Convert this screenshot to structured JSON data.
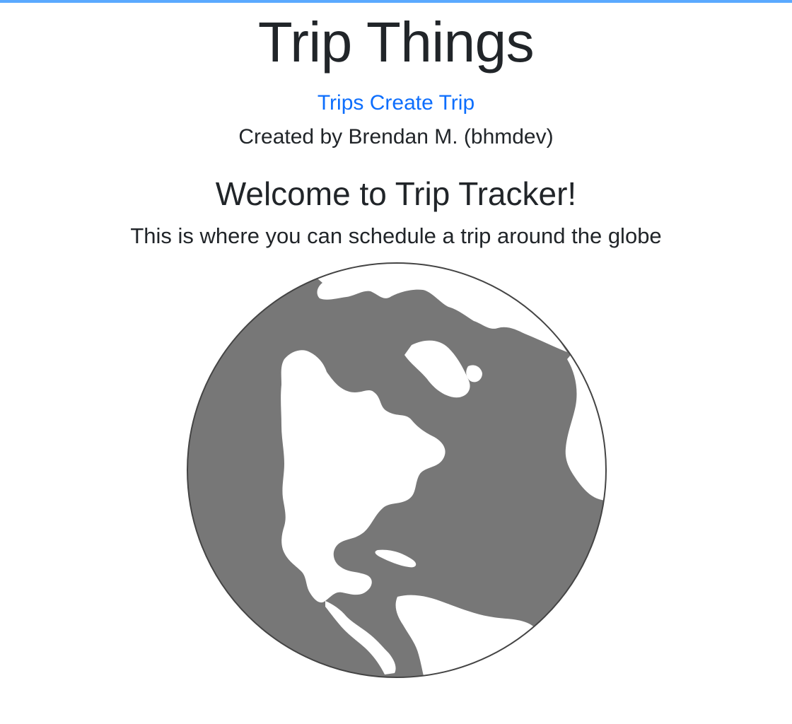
{
  "header": {
    "title": "Trip Things",
    "nav": {
      "trips_label": "Trips",
      "create_trip_label": "Create Trip"
    },
    "credit": "Created by Brendan M. (bhmdev)"
  },
  "main": {
    "welcome_title": "Welcome to Trip Tracker!",
    "welcome_subtitle": "This is where you can schedule a trip around the globe",
    "image_icon": "globe-icon"
  },
  "colors": {
    "accent_bar": "#5aa9ff",
    "link": "#0d6efd",
    "text": "#212529",
    "globe_ocean": "#777777",
    "globe_land": "#ffffff"
  }
}
